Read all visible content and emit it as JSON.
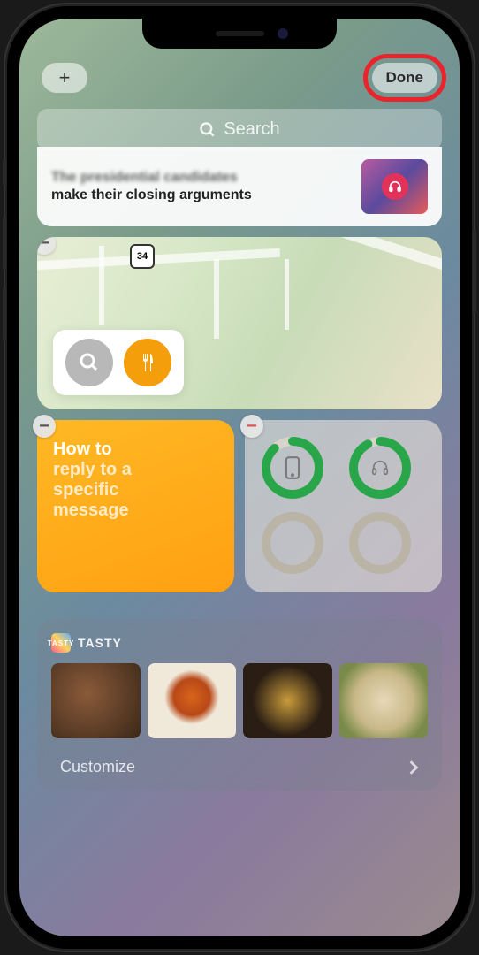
{
  "topbar": {
    "add_label": "+",
    "done_label": "Done"
  },
  "search": {
    "placeholder": "Search"
  },
  "news": {
    "headline_line1": "The presidential candidates",
    "headline_line2": "make their closing arguments"
  },
  "map": {
    "route_label": "34",
    "remove_label": "−"
  },
  "notes": {
    "line1": "How to",
    "line2a": "reply to a",
    "line2b": "specific",
    "line2c": "message",
    "remove_label": "−"
  },
  "batteries": {
    "remove_label": "−",
    "devices": [
      {
        "name": "phone",
        "level": 0.88
      },
      {
        "name": "headphones",
        "level": 0.92
      }
    ]
  },
  "tasty": {
    "title": "TASTY",
    "logo_text": "TASTY"
  },
  "customize": {
    "label": "Customize"
  }
}
